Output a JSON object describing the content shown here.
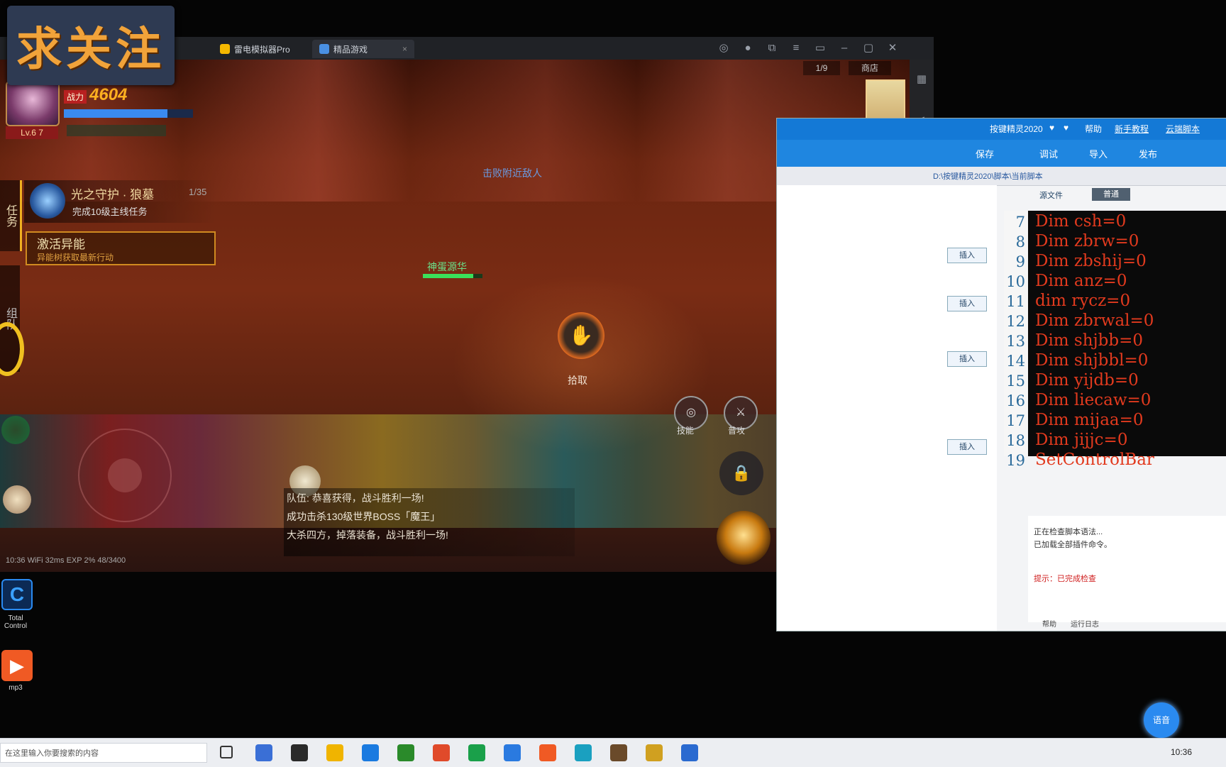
{
  "overlay": {
    "badge_text": "求关注"
  },
  "emulator": {
    "tabs": [
      {
        "label": "雷电模拟器Pro",
        "color": "#f5b800"
      },
      {
        "label": "精品游戏",
        "color": "#4a90e2"
      }
    ],
    "controls": [
      "◎",
      "●",
      "⧉",
      "≡",
      "▭",
      "–",
      "▢",
      "✕"
    ],
    "sidebar_icons": [
      "▦",
      "◂",
      "◃",
      "⤢",
      "✂",
      "▣",
      "⊞",
      "⚙",
      "▤",
      "↩",
      "⌂",
      "▭"
    ]
  },
  "game": {
    "player": {
      "combat_power_label": "战力",
      "combat_power": "4604",
      "level": "Lv.6 7"
    },
    "quest_title": "光之守护 · 狼墓",
    "quest_count": "1/35",
    "quest_desc": "完成10级主线任务",
    "event_title": "激活异能",
    "event_desc": "异能树获取最新行动",
    "side_tabs": [
      "任务",
      "组队"
    ],
    "center_hint": "击败附近敌人",
    "npc_name": "神蛋源华",
    "action_label": "拾取",
    "skill_labels": [
      "技能",
      "普攻"
    ],
    "top_right": [
      "1/9",
      "商店"
    ],
    "chat_lines": [
      "队伍: 恭喜获得，战斗胜利一场!",
      "成功击杀130级世界BOSS「魔王」",
      "大杀四方，掉落装备，战斗胜利一场!"
    ],
    "status_bar": "10:36  WiFi  32ms  EXP 2%  48/3400"
  },
  "editor": {
    "title_items": [
      "按键精灵2020",
      "♥",
      "♥",
      "帮助",
      "新手教程",
      "云端脚本"
    ],
    "toolbar": [
      "保存",
      "调试",
      "导入",
      "发布"
    ],
    "path": "D:\\按键精灵2020\\脚本\\当前脚本",
    "panel_tabs": [
      "源文件",
      "普通"
    ],
    "insert_buttons": [
      "插入",
      "插入",
      "插入",
      "插入"
    ],
    "code_start_line": 7,
    "code_lines": [
      "Dim csh=0",
      "Dim zbrw=0",
      "Dim zbshij=0",
      "Dim anz=0",
      "dim rycz=0",
      "Dim zbrwal=0",
      "Dim shjbb=0",
      "Dim shjbbl=0",
      "Dim yijdb=0",
      "Dim liecaw=0",
      "Dim mijaa=0",
      "Dim jijjc=0",
      "SetControlBar"
    ],
    "message_lines": [
      "正在检查脚本语法...",
      "已加载全部插件命令。"
    ],
    "message_error": "提示：已完成检查",
    "status_tabs": [
      "帮助",
      "运行日志"
    ]
  },
  "desktop": {
    "icons": [
      {
        "label": "Total Control",
        "color": "#1a6fd1"
      },
      {
        "label": "mp3",
        "color": "#f05a24"
      }
    ],
    "float_button": "语音"
  },
  "taskbar": {
    "search_placeholder": "在这里输入你要搜索的内容",
    "apps": [
      "#3a6fd6",
      "#2a2a2a",
      "#f0b400",
      "#1a7ae0",
      "#2a8a2a",
      "#e04a2a",
      "#1aa04a",
      "#2a7ae0",
      "#f05a24",
      "#1aa0c0",
      "#6a4a2a",
      "#d0a020",
      "#2a6ad0"
    ],
    "tray": "10:36"
  }
}
